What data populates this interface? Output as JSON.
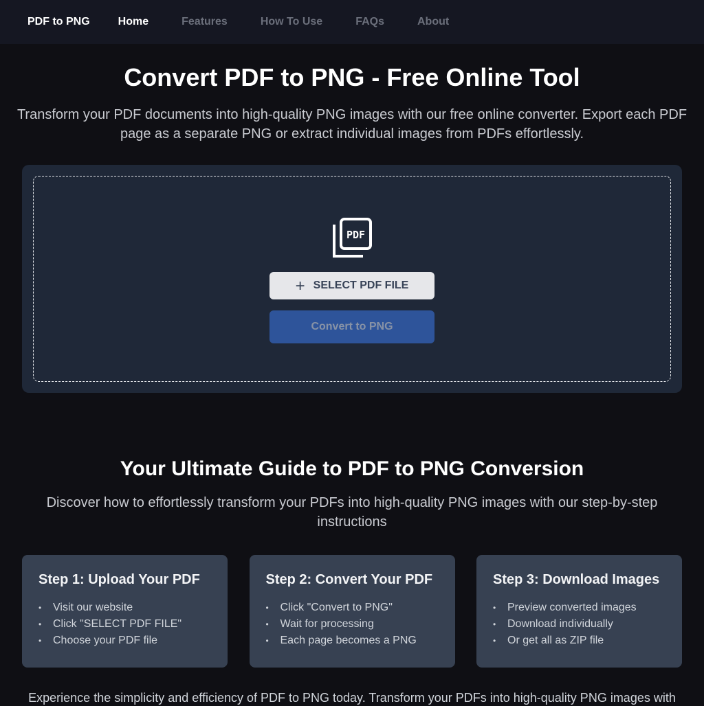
{
  "nav": {
    "brand": "PDF to PNG",
    "links": [
      {
        "label": "Home",
        "active": true
      },
      {
        "label": "Features",
        "active": false
      },
      {
        "label": "How To Use",
        "active": false
      },
      {
        "label": "FAQs",
        "active": false
      },
      {
        "label": "About",
        "active": false
      }
    ]
  },
  "hero": {
    "title": "Convert PDF to PNG - Free Online Tool",
    "description": "Transform your PDF documents into high-quality PNG images with our free online converter. Export each PDF page as a separate PNG or extract individual images from PDFs effortlessly."
  },
  "upload": {
    "icon": "pdf-file-icon",
    "icon_text": "PDF",
    "select_button": "SELECT PDF FILE",
    "select_icon": "+",
    "convert_button": "Convert to PNG"
  },
  "guide": {
    "title": "Your Ultimate Guide to PDF to PNG Conversion",
    "subtitle": "Discover how to effortlessly transform your PDFs into high-quality PNG images with our step-by-step instructions",
    "steps": [
      {
        "title": "Step 1: Upload Your PDF",
        "items": [
          "Visit our website",
          "Click \"SELECT PDF FILE\"",
          "Choose your PDF file"
        ]
      },
      {
        "title": "Step 2: Convert Your PDF",
        "items": [
          "Click \"Convert to PNG\"",
          "Wait for processing",
          "Each page becomes a PNG"
        ]
      },
      {
        "title": "Step 3: Download Images",
        "items": [
          "Preview converted images",
          "Download individually",
          "Or get all as ZIP file"
        ]
      }
    ]
  },
  "footer": {
    "text": "Experience the simplicity and efficiency of PDF to PNG today. Transform your PDFs into high-quality PNG images with"
  },
  "colors": {
    "background": "#0f0f14",
    "navbar": "#151722",
    "card": "#1f2838",
    "step_card": "#374152",
    "primary_button": "#2e549a",
    "secondary_button": "#e6e7ea"
  }
}
